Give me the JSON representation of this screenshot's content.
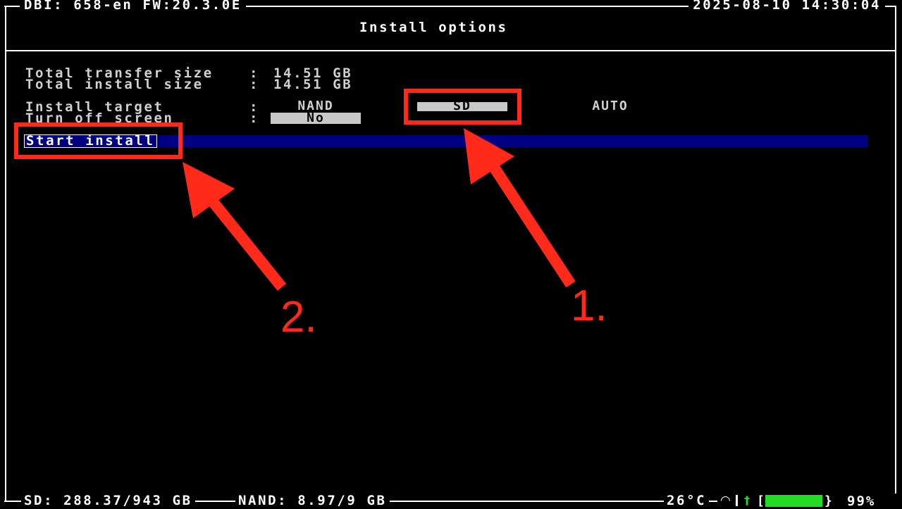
{
  "header": {
    "app_version": "DBI: 658-en FW:20.3.0E",
    "datetime": "2025-08-10 14:30:04",
    "title": "Install options"
  },
  "info": {
    "transfer_label": "Total transfer size",
    "transfer_value": "14.51 GB",
    "install_label": "Total install size",
    "install_value": "14.51 GB",
    "separator": ":"
  },
  "install_target": {
    "label": "Install target",
    "options": [
      "NAND",
      "SD",
      "AUTO"
    ],
    "selected": "SD"
  },
  "screen_off": {
    "label": "Turn off screen",
    "value": "No"
  },
  "actions": {
    "start_install": "Start install"
  },
  "annotations": {
    "step1": "1.",
    "step2": "2.",
    "color": "#ff2a1a"
  },
  "footer": {
    "sd": "SD: 288.37/943 GB",
    "nand": "NAND: 8.97/9 GB",
    "temp": "26°C",
    "battery_percent": "99%",
    "battery_level": 0.99
  },
  "colors": {
    "highlight": "#000080",
    "battery": "#22dd22",
    "selected_option_bg": "#c8c8c8"
  }
}
